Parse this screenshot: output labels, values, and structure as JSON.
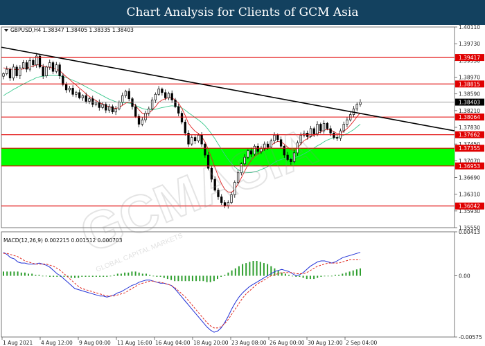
{
  "header": {
    "title": "Chart Analysis for Clients of GCM Asia"
  },
  "watermark": {
    "main": "GCMASIA",
    "sub": "GLOBAL CAPITAL MARKETS"
  },
  "chart_data": [
    {
      "type": "candlestick",
      "title": "GBPUSD,H4 1.38347 1.38405 1.38335 1.38403",
      "symbol": "GBPUSD,H4",
      "quote": "1.38347 1.38405 1.38335 1.38403",
      "ylim": [
        1.3555,
        1.4011
      ],
      "y_ticks": [
        "1.40110",
        "1.39730",
        "1.39350",
        "1.38970",
        "1.38590",
        "1.38210",
        "1.37830",
        "1.37450",
        "1.37070",
        "1.36690",
        "1.36310",
        "1.35930",
        "1.35550"
      ],
      "x_ticks": [
        "1 Aug 2021",
        "4 Aug 12:00",
        "9 Aug 00:00",
        "11 Aug 16:00",
        "16 Aug 04:00",
        "18 Aug 20:00",
        "23 Aug 08:00",
        "26 Aug 00:00",
        "30 Aug 12:00",
        "2 Sep 04:00"
      ],
      "current_price": "1.38403",
      "levels": [
        {
          "label": "1.39417",
          "value": 1.39417
        },
        {
          "label": "1.38815",
          "value": 1.38815
        },
        {
          "label": "1.38064",
          "value": 1.38064
        },
        {
          "label": "1.37662",
          "value": 1.37662
        },
        {
          "label": "1.37355",
          "value": 1.37355
        },
        {
          "label": "1.36953",
          "value": 1.36953
        },
        {
          "label": "1.36042",
          "value": 1.36042
        }
      ],
      "zone": {
        "from": 1.36953,
        "to": 1.37355,
        "color": "#00ff00"
      },
      "trendline": {
        "start": 1.3965,
        "end": 1.3775
      },
      "closes": [
        1.3905,
        1.3915,
        1.3895,
        1.392,
        1.39,
        1.3918,
        1.393,
        1.3915,
        1.3935,
        1.3925,
        1.3945,
        1.392,
        1.39,
        1.392,
        1.393,
        1.391,
        1.3925,
        1.39,
        1.388,
        1.3868,
        1.3872,
        1.3858,
        1.3862,
        1.385,
        1.3855,
        1.3842,
        1.3848,
        1.3835,
        1.384,
        1.3828,
        1.3835,
        1.3822,
        1.383,
        1.3818,
        1.3825,
        1.384,
        1.3855,
        1.3865,
        1.3848,
        1.383,
        1.3808,
        1.379,
        1.38,
        1.3815,
        1.3825,
        1.3845,
        1.3858,
        1.387,
        1.3862,
        1.385,
        1.386,
        1.3845,
        1.383,
        1.3815,
        1.3795,
        1.377,
        1.3745,
        1.376,
        1.3752,
        1.3765,
        1.3745,
        1.372,
        1.369,
        1.3665,
        1.364,
        1.3625,
        1.3612,
        1.3605,
        1.3612,
        1.363,
        1.3658,
        1.368,
        1.37,
        1.3715,
        1.373,
        1.3722,
        1.374,
        1.3728,
        1.3735,
        1.3745,
        1.3738,
        1.3752,
        1.3765,
        1.3755,
        1.374,
        1.372,
        1.371,
        1.3705,
        1.3725,
        1.3748,
        1.3765,
        1.377,
        1.3762,
        1.378,
        1.3768,
        1.379,
        1.3775,
        1.3792,
        1.378,
        1.377,
        1.376,
        1.3758,
        1.3775,
        1.379,
        1.38,
        1.3812,
        1.3825,
        1.3835,
        1.384
      ],
      "ma_fast": [
        1.3918,
        1.3917,
        1.3915,
        1.3915,
        1.3914,
        1.3914,
        1.3916,
        1.3917,
        1.392,
        1.3922,
        1.3925,
        1.3925,
        1.3922,
        1.392,
        1.392,
        1.3917,
        1.3915,
        1.3912,
        1.3905,
        1.3898,
        1.3892,
        1.3885,
        1.3879,
        1.3872,
        1.3866,
        1.3859,
        1.3853,
        1.3848,
        1.3844,
        1.3839,
        1.3836,
        1.3832,
        1.383,
        1.3827,
        1.3826,
        1.3828,
        1.3833,
        1.3838,
        1.384,
        1.3838,
        1.3832,
        1.3823,
        1.3815,
        1.3812,
        1.3815,
        1.3822,
        1.383,
        1.384,
        1.3845,
        1.3848,
        1.3851,
        1.385,
        1.3845,
        1.3838,
        1.3826,
        1.381,
        1.3792,
        1.3782,
        1.3774,
        1.3769,
        1.3762,
        1.375,
        1.3733,
        1.3713,
        1.3692,
        1.3672,
        1.3655,
        1.3642,
        1.3636,
        1.3635,
        1.3642,
        1.3654,
        1.3668,
        1.3683,
        1.3698,
        1.3708,
        1.3718,
        1.3722,
        1.3727,
        1.3733,
        1.3736,
        1.3741,
        1.3748,
        1.3751,
        1.375,
        1.3745,
        1.3738,
        1.3732,
        1.3731,
        1.3736,
        1.3745,
        1.3753,
        1.3757,
        1.3763,
        1.3765,
        1.377,
        1.3772,
        1.3777,
        1.3778,
        1.3777,
        1.3773,
        1.3769,
        1.377,
        1.3774,
        1.378,
        1.3788,
        1.3797,
        1.3807,
        1.3816
      ],
      "ma_slow": [
        1.3855,
        1.386,
        1.3864,
        1.3869,
        1.3873,
        1.3877,
        1.3881,
        1.3885,
        1.3889,
        1.3892,
        1.3896,
        1.3898,
        1.3899,
        1.39,
        1.3901,
        1.3901,
        1.3901,
        1.39,
        1.3898,
        1.3896,
        1.3893,
        1.389,
        1.3887,
        1.3883,
        1.3879,
        1.3875,
        1.3871,
        1.3867,
        1.3863,
        1.3859,
        1.3855,
        1.3851,
        1.3847,
        1.3844,
        1.3841,
        1.384,
        1.3839,
        1.3839,
        1.3838,
        1.3836,
        1.3833,
        1.3829,
        1.3826,
        1.3824,
        1.3823,
        1.3823,
        1.3824,
        1.3826,
        1.3828,
        1.3829,
        1.3831,
        1.3832,
        1.3831,
        1.383,
        1.3827,
        1.3822,
        1.3816,
        1.3811,
        1.3805,
        1.38,
        1.3794,
        1.3787,
        1.3778,
        1.3768,
        1.3757,
        1.3745,
        1.3733,
        1.3721,
        1.371,
        1.3701,
        1.3693,
        1.3687,
        1.3683,
        1.3681,
        1.368,
        1.368,
        1.3682,
        1.3684,
        1.3687,
        1.369,
        1.3694,
        1.3698,
        1.3703,
        1.3707,
        1.371,
        1.3712,
        1.3713,
        1.3713,
        1.3714,
        1.3716,
        1.3719,
        1.3723,
        1.3727,
        1.3732,
        1.3736,
        1.3741,
        1.3745,
        1.375,
        1.3754,
        1.3757,
        1.3759,
        1.376,
        1.3762,
        1.3765,
        1.3769,
        1.3773,
        1.3778,
        1.3784,
        1.379
      ]
    },
    {
      "type": "macd",
      "title": "MACD(12,26,9) 0.002215 0.001512 0.000703",
      "label": "MACD(12,26,9)",
      "values_text": "0.002215 0.001512 0.000703",
      "ylim": [
        -0.00575,
        0.00413
      ],
      "y_ticks": [
        "0.00413",
        "0.00",
        "-0.00575"
      ],
      "macd": [
        0.0022,
        0.002,
        0.0017,
        0.0016,
        0.0013,
        0.0012,
        0.0012,
        0.0011,
        0.0011,
        0.0011,
        0.0012,
        0.0011,
        0.001,
        0.0008,
        0.0005,
        0.0002,
        0.0,
        -0.0003,
        -0.0006,
        -0.0009,
        -0.0012,
        -0.0013,
        -0.0014,
        -0.0015,
        -0.0016,
        -0.0017,
        -0.0018,
        -0.0019,
        -0.0019,
        -0.002,
        -0.0019,
        -0.0018,
        -0.0016,
        -0.0015,
        -0.0013,
        -0.0011,
        -0.0009,
        -0.0008,
        -0.0006,
        -0.0005,
        -0.0004,
        -0.0004,
        -0.0005,
        -0.0006,
        -0.0007,
        -0.0007,
        -0.0008,
        -0.0009,
        -0.0012,
        -0.0016,
        -0.002,
        -0.0024,
        -0.0028,
        -0.0032,
        -0.0036,
        -0.004,
        -0.0044,
        -0.0048,
        -0.0051,
        -0.0053,
        -0.0052,
        -0.0049,
        -0.0044,
        -0.0038,
        -0.0031,
        -0.0025,
        -0.002,
        -0.0016,
        -0.0013,
        -0.001,
        -0.0008,
        -0.0006,
        -0.0004,
        -0.0002,
        0.0,
        0.0002,
        0.0004,
        0.0005,
        0.0006,
        0.0005,
        0.0004,
        0.0002,
        0.0,
        0.0001,
        0.0003,
        0.0006,
        0.0009,
        0.0011,
        0.0013,
        0.0014,
        0.0014,
        0.0013,
        0.0012,
        0.0013,
        0.0015,
        0.0017,
        0.0018,
        0.0019,
        0.002,
        0.0021,
        0.0022
      ],
      "signal": [
        0.0021,
        0.0021,
        0.002,
        0.0019,
        0.0018,
        0.0016,
        0.0014,
        0.0013,
        0.0012,
        0.0011,
        0.0011,
        0.0011,
        0.0011,
        0.001,
        0.0009,
        0.0007,
        0.0005,
        0.0002,
        -0.0001,
        -0.0004,
        -0.0007,
        -0.001,
        -0.0012,
        -0.0013,
        -0.0014,
        -0.0015,
        -0.0016,
        -0.0017,
        -0.0018,
        -0.0019,
        -0.0019,
        -0.0019,
        -0.0018,
        -0.0017,
        -0.0016,
        -0.0014,
        -0.0012,
        -0.001,
        -0.0008,
        -0.0007,
        -0.0006,
        -0.0005,
        -0.0005,
        -0.0006,
        -0.0006,
        -0.0007,
        -0.0008,
        -0.0009,
        -0.0011,
        -0.0014,
        -0.0017,
        -0.002,
        -0.0024,
        -0.0028,
        -0.0032,
        -0.0036,
        -0.004,
        -0.0044,
        -0.0047,
        -0.0049,
        -0.0049,
        -0.0048,
        -0.0045,
        -0.0041,
        -0.0036,
        -0.0031,
        -0.0026,
        -0.0021,
        -0.0017,
        -0.0014,
        -0.0011,
        -0.0008,
        -0.0006,
        -0.0004,
        -0.0002,
        0.0,
        0.0001,
        0.0002,
        0.0003,
        0.0003,
        0.0003,
        0.0003,
        0.0002,
        0.0002,
        0.0002,
        0.0003,
        0.0005,
        0.0007,
        0.0009,
        0.001,
        0.0011,
        0.0012,
        0.0012,
        0.0012,
        0.0012,
        0.0013,
        0.0014,
        0.0015,
        0.0015,
        0.0015,
        0.0015
      ],
      "hist": [
        0.0004,
        0.0004,
        0.0004,
        0.0004,
        0.0004,
        0.0003,
        0.0003,
        0.0002,
        0.0002,
        0.0001,
        0.0001,
        0.0,
        0.0,
        -0.0001,
        -0.0001,
        -0.0001,
        -0.0001,
        -0.0001,
        -0.0001,
        -0.0002,
        -0.0002,
        -0.0002,
        -0.0001,
        -0.0001,
        -0.0001,
        -0.0001,
        -0.0001,
        -0.0001,
        -0.0001,
        -0.0001,
        0.0,
        0.0001,
        0.0002,
        0.0002,
        0.0003,
        0.0003,
        0.0004,
        0.0004,
        0.0003,
        0.0002,
        0.0002,
        0.0001,
        0.0,
        -0.0001,
        -0.0001,
        -0.0002,
        -0.0003,
        -0.0004,
        -0.0005,
        -0.0005,
        -0.0005,
        -0.0005,
        -0.0005,
        -0.0005,
        -0.0005,
        -0.0005,
        -0.0005,
        -0.0006,
        -0.0006,
        -0.0005,
        -0.0003,
        -0.0001,
        0.0001,
        0.0003,
        0.0005,
        0.0007,
        0.0009,
        0.0011,
        0.0012,
        0.0013,
        0.0014,
        0.0014,
        0.0013,
        0.0012,
        0.0011,
        0.0009,
        0.0007,
        0.0005,
        0.0003,
        0.0002,
        0.0001,
        0.0,
        -0.0001,
        -0.0001,
        -0.0002,
        -0.0003,
        -0.0003,
        -0.0003,
        -0.0002,
        -0.0001,
        0.0,
        0.0,
        0.0,
        0.0001,
        0.0001,
        0.0002,
        0.0003,
        0.0004,
        0.0005,
        0.0006,
        0.0007
      ],
      "colors": {
        "macd": "#1f2fd6",
        "signal": "#e0281e",
        "hist": "#2e9e2e"
      }
    }
  ]
}
